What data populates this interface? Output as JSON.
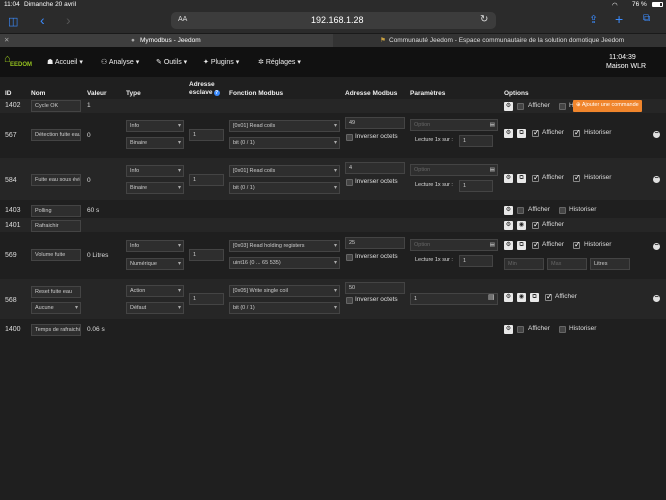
{
  "statusbar": {
    "time": "11:04",
    "date": "Dimanche 20 avril",
    "battery": "76 %"
  },
  "browser": {
    "text_size_label": "AA",
    "url": "192.168.1.28"
  },
  "tabs": [
    {
      "title": "Mymodbus - Jeedom"
    },
    {
      "title": "Communauté Jeedom - Espace communautaire de la solution domotique Jeedom"
    }
  ],
  "nav": {
    "logo": "EEDOM",
    "items": [
      "Accueil",
      "Analyse",
      "Outils",
      "Plugins",
      "Réglages"
    ],
    "clock": "11:04:39",
    "user": "Maison WLR"
  },
  "table": {
    "headers": {
      "id": "ID",
      "nom": "Nom",
      "valeur": "Valeur",
      "type": "Type",
      "adresse": "Adresse esclave",
      "fonction": "Fonction Modbus",
      "adresse_modbus": "Adresse Modbus",
      "parametres": "Paramètres",
      "options": "Options"
    },
    "add_button": "Ajouter une commande",
    "labels": {
      "afficher": "Afficher",
      "historiser": "Historiser",
      "inverser": "Inverser octets",
      "lecture": "Lecture 1x sur :",
      "option_ph": "Option",
      "min_ph": "Min",
      "max_ph": "Max"
    },
    "rows": [
      {
        "id": "1402",
        "name": "Cycle OK",
        "value": "1"
      },
      {
        "id": "567",
        "name": "Détection fuite eau",
        "value": "0",
        "type": "Info",
        "subtype": "Binaire",
        "slave": "1",
        "function": "[0x01] Read coils",
        "format": "bit (0 / 1)",
        "address": "49",
        "lecture": "1"
      },
      {
        "id": "584",
        "name": "Fuite eau sous évier",
        "value": "0",
        "type": "Info",
        "subtype": "Binaire",
        "slave": "1",
        "function": "[0x01] Read coils",
        "format": "bit (0 / 1)",
        "address": "4",
        "lecture": "1"
      },
      {
        "id": "1403",
        "name": "Polling",
        "value": "60 s"
      },
      {
        "id": "1401",
        "name": "Rafraichir",
        "value": ""
      },
      {
        "id": "569",
        "name": "Volume fuite",
        "value": "0 Litres",
        "type": "Info",
        "subtype": "Numérique",
        "slave": "1",
        "function": "[0x03] Read holding registers",
        "format": "uint16 (0 ... 65 535)",
        "address": "25",
        "lecture": "1",
        "unit": "Litres"
      },
      {
        "id": "568",
        "name": "Reset fuite eau",
        "value": "",
        "type": "Action",
        "subtype": "Défaut",
        "extra": "Aucune",
        "slave": "1",
        "function": "[0x05] Write single coil",
        "format": "bit (0 / 1)",
        "address": "50",
        "param": "1"
      },
      {
        "id": "1400",
        "name": "Temps de rafraichissement",
        "value": "0.06 s"
      }
    ]
  }
}
